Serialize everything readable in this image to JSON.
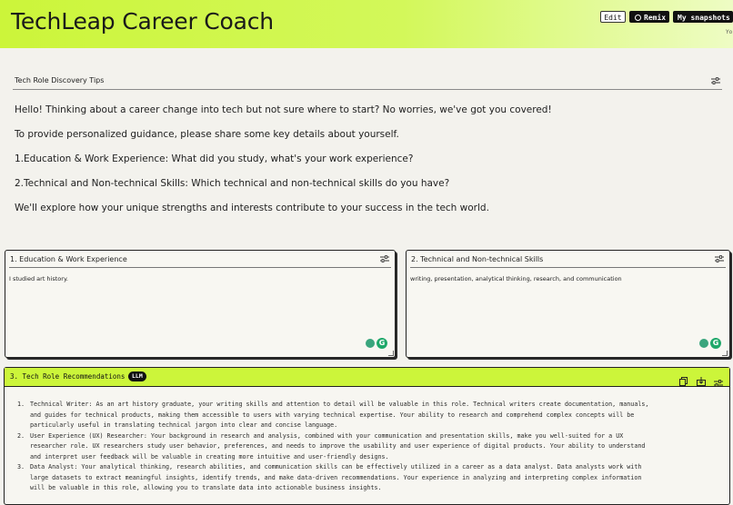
{
  "header": {
    "title": "TechLeap Career Coach",
    "edit_label": "Edit",
    "remix_label": "Remix",
    "snapshots_label": "My snapshots",
    "user_label": "Yo"
  },
  "tips": {
    "title": "Tech Role Discovery Tips",
    "paragraphs": [
      "Hello! Thinking about a career change into tech but not sure where to start? No worries, we've got you covered!",
      "To provide personalized guidance, please share some key details about yourself.",
      "1.Education & Work Experience: What did you study, what's your work experience?",
      "2.Technical and Non-technical Skills: Which technical and non-technical skills do you have?",
      "We'll explore how your unique strengths and interests contribute to your success in the tech world."
    ]
  },
  "education_card": {
    "title": "1. Education & Work Experience",
    "value": "I studied art history."
  },
  "skills_card": {
    "title": "2. Technical and Non-technical Skills",
    "value": "writing, presentation, analytical thinking, research, and communication"
  },
  "recommendations": {
    "title": "3. Tech Role Recommendations",
    "badge": "LLM",
    "items": [
      {
        "num": "1.",
        "lines": [
          "Technical Writer: As an art history graduate, your writing skills and attention to detail will be valuable in this role. Technical writers create documentation, manuals,",
          "and guides for technical products, making them accessible to users with varying technical expertise. Your ability to research and comprehend complex concepts will be",
          "particularly useful in translating technical jargon into clear and concise language."
        ]
      },
      {
        "num": "2.",
        "lines": [
          "User Experience (UX) Researcher: Your background in research and analysis, combined with your communication and presentation skills, make you well-suited for a UX",
          "researcher role. UX researchers study user behavior, preferences, and needs to improve the usability and user experience of digital products. Your ability to understand",
          "and interpret user feedback will be valuable in creating more intuitive and user-friendly designs."
        ]
      },
      {
        "num": "3.",
        "lines": [
          "Data Analyst: Your analytical thinking, research abilities, and communication skills can be effectively utilized in a career as a data analyst. Data analysts work with",
          "large datasets to extract meaningful insights, identify trends, and make data-driven recommendations. Your experience in analyzing and interpreting complex information",
          "will be valuable in this role, allowing you to translate data into actionable business insights."
        ]
      }
    ]
  },
  "colors": {
    "accent": "#ccf53a",
    "background": "#f3f2ed",
    "grammar_badge": "#1ea86a"
  },
  "icons": [
    "sliders-icon",
    "copy-icon",
    "download-icon",
    "lightbulb-icon",
    "grammarly-icon",
    "resize-grip-icon"
  ]
}
